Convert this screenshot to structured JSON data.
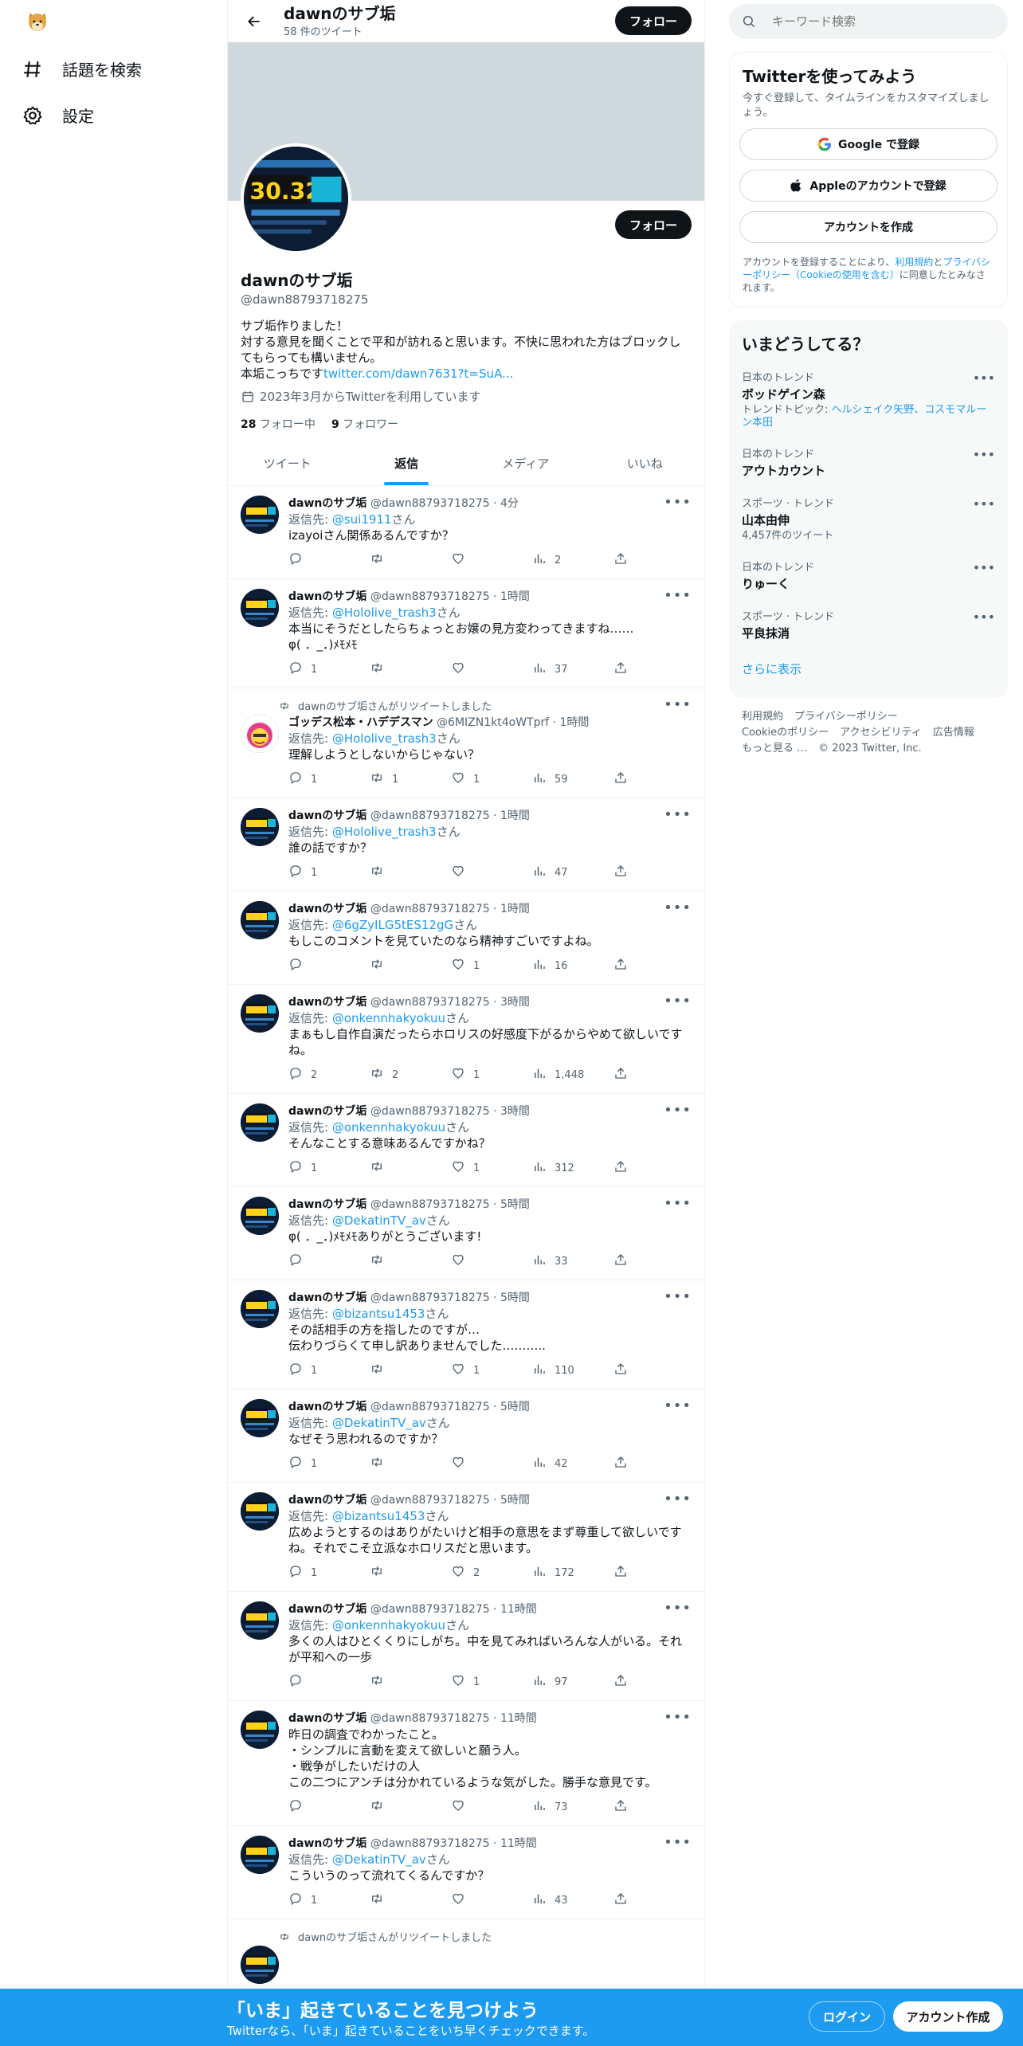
{
  "nav": {
    "explore_label": "話題を検索",
    "settings_label": "設定"
  },
  "profile": {
    "name": "dawnのサブ垢",
    "tweet_count": "58 件のツイート",
    "follow_label": "フォロー",
    "handle": "@dawn88793718275",
    "bio": "サブ垢作りました！\n対する意見を聞くことで平和が訪れると思います。不快に思われた方はブロックしてもらっても構いません。\n本垢こっちです",
    "bio_link": "twitter.com/dawn7631?t=SuA...",
    "joined": "2023年3月からTwitterを利用しています",
    "following_count": "28",
    "following_label": "フォロー中",
    "followers_count": "9",
    "followers_label": "フォロワー",
    "avatar_text": "30.325"
  },
  "tabs": [
    "ツイート",
    "返信",
    "メディア",
    "いいね"
  ],
  "tweets": [
    {
      "name": "dawnのサブ垢",
      "meta": "@dawn88793718275 · 4分",
      "reply_prefix": "返信先: ",
      "reply_to": "@sui1911",
      "reply_suffix": "さん",
      "text": "izayoiさん関係あるんですか？",
      "replies": "",
      "retweets": "",
      "likes": "",
      "views": "2"
    },
    {
      "name": "dawnのサブ垢",
      "meta": "@dawn88793718275 · 1時間",
      "reply_prefix": "返信先: ",
      "reply_to": "@Hololive_trash3",
      "reply_suffix": "さん",
      "text": "本当にそうだとしたらちょっとお嬢の見方変わってきますね……\nφ( ．_．)ﾒﾓﾒﾓ",
      "replies": "1",
      "retweets": "",
      "likes": "",
      "views": "37"
    },
    {
      "retweet_banner": "dawnのサブ垢さんがリツイートしました",
      "name": "ゴッデス松本・ハデデスマン",
      "meta": "@6MIZN1kt4oWTprf · 1時間",
      "reply_prefix": "返信先: ",
      "reply_to": "@Hololive_trash3",
      "reply_suffix": "さん",
      "text": "理解しようとしないからじゃない？",
      "replies": "1",
      "retweets": "1",
      "likes": "1",
      "views": "59"
    },
    {
      "name": "dawnのサブ垢",
      "meta": "@dawn88793718275 · 1時間",
      "reply_prefix": "返信先: ",
      "reply_to": "@Hololive_trash3",
      "reply_suffix": "さん",
      "text": "誰の話ですか？",
      "replies": "1",
      "retweets": "",
      "likes": "",
      "views": "47"
    },
    {
      "name": "dawnのサブ垢",
      "meta": "@dawn88793718275 · 1時間",
      "reply_prefix": "返信先: ",
      "reply_to": "@6gZyILG5tES12gG",
      "reply_suffix": "さん",
      "text": "もしこのコメントを見ていたのなら精神すごいですよね。",
      "replies": "",
      "retweets": "",
      "likes": "1",
      "views": "16"
    },
    {
      "name": "dawnのサブ垢",
      "meta": "@dawn88793718275 · 3時間",
      "reply_prefix": "返信先: ",
      "reply_to": "@onkennhakyokuu",
      "reply_suffix": "さん",
      "text": "まぁもし自作自演だったらホロリスの好感度下がるからやめて欲しいですね。",
      "replies": "2",
      "retweets": "2",
      "likes": "1",
      "views": "1,448"
    },
    {
      "name": "dawnのサブ垢",
      "meta": "@dawn88793718275 · 3時間",
      "reply_prefix": "返信先: ",
      "reply_to": "@onkennhakyokuu",
      "reply_suffix": "さん",
      "text": "そんなことする意味あるんですかね？",
      "replies": "1",
      "retweets": "",
      "likes": "1",
      "views": "312"
    },
    {
      "name": "dawnのサブ垢",
      "meta": "@dawn88793718275 · 5時間",
      "reply_prefix": "返信先: ",
      "reply_to": "@DekatinTV_av",
      "reply_suffix": "さん",
      "text": "φ( ．_．)ﾒﾓﾒﾓありがとうございます!",
      "replies": "",
      "retweets": "",
      "likes": "",
      "views": "33"
    },
    {
      "name": "dawnのサブ垢",
      "meta": "@dawn88793718275 · 5時間",
      "reply_prefix": "返信先: ",
      "reply_to": "@bizantsu1453",
      "reply_suffix": "さん",
      "text": "その話相手の方を指したのですが…\n伝わりづらくて申し訳ありませんでした………..",
      "replies": "1",
      "retweets": "",
      "likes": "1",
      "views": "110"
    },
    {
      "name": "dawnのサブ垢",
      "meta": "@dawn88793718275 · 5時間",
      "reply_prefix": "返信先: ",
      "reply_to": "@DekatinTV_av",
      "reply_suffix": "さん",
      "text": "なぜそう思われるのですか？",
      "replies": "1",
      "retweets": "",
      "likes": "",
      "views": "42"
    },
    {
      "name": "dawnのサブ垢",
      "meta": "@dawn88793718275 · 5時間",
      "reply_prefix": "返信先: ",
      "reply_to": "@bizantsu1453",
      "reply_suffix": "さん",
      "text": "広めようとするのはありがたいけど相手の意思をまず尊重して欲しいですね。それでこそ立派なホロリスだと思います。",
      "replies": "1",
      "retweets": "",
      "likes": "2",
      "views": "172"
    },
    {
      "name": "dawnのサブ垢",
      "meta": "@dawn88793718275 · 11時間",
      "reply_prefix": "返信先: ",
      "reply_to": "@onkennhakyokuu",
      "reply_suffix": "さん",
      "text": "多くの人はひとくくりにしがち。中を見てみればいろんな人がいる。それが平和への一歩",
      "replies": "",
      "retweets": "",
      "likes": "1",
      "views": "97"
    },
    {
      "name": "dawnのサブ垢",
      "meta": "@dawn88793718275 · 11時間",
      "reply_prefix": "",
      "reply_to": "",
      "reply_suffix": "",
      "text": "昨日の調査でわかったこと。\n・シンプルに言動を変えて欲しいと願う人。\n・戦争がしたいだけの人\nこの二つにアンチは分かれているような気がした。勝手な意見です。",
      "replies": "",
      "retweets": "",
      "likes": "",
      "views": "73"
    },
    {
      "name": "dawnのサブ垢",
      "meta": "@dawn88793718275 · 11時間",
      "reply_prefix": "返信先: ",
      "reply_to": "@DekatinTV_av",
      "reply_suffix": "さん",
      "text": "こういうのって流れてくるんですか？",
      "replies": "1",
      "retweets": "",
      "likes": "",
      "views": "43"
    },
    {
      "retweet_banner": "dawnのサブ垢さんがリツイートしました",
      "name": "",
      "meta": "",
      "reply_prefix": "",
      "reply_to": "",
      "reply_suffix": "",
      "text": "",
      "replies": "",
      "retweets": "",
      "likes": "",
      "views": ""
    }
  ],
  "search": {
    "placeholder": "キーワード検索"
  },
  "signup": {
    "title": "Twitterを使ってみよう",
    "subtitle": "今すぐ登録して、タイムラインをカスタマイズしましょう。",
    "google": "Google で登録",
    "apple": "Appleのアカウントで登録",
    "create": "アカウントを作成",
    "terms_prefix": "アカウントを登録することにより、",
    "terms_link1": "利用規約",
    "terms_mid": "と",
    "terms_link2": "プライバシーポリシー（Cookieの使用を含む）",
    "terms_suffix": "に同意したとみなされます。"
  },
  "trends": {
    "title": "いまどうしてる？",
    "items": [
      {
        "category": "日本のトレンド",
        "title": "ボッドゲイン森",
        "sub_prefix": "トレンドトピック: ",
        "sub_link": "ヘルシェイク矢野、コスモマルーン本田"
      },
      {
        "category": "日本のトレンド",
        "title": "アウトカウント",
        "sub_prefix": "",
        "sub_link": ""
      },
      {
        "category": "スポーツ · トレンド",
        "title": "山本由伸",
        "sub_prefix": "4,457件のツイート",
        "sub_link": ""
      },
      {
        "category": "日本のトレンド",
        "title": "りゅーく",
        "sub_prefix": "",
        "sub_link": ""
      },
      {
        "category": "スポーツ · トレンド",
        "title": "平良抹消",
        "sub_prefix": "",
        "sub_link": ""
      }
    ],
    "show_more": "さらに表示"
  },
  "footer": [
    "利用規約",
    "プライバシーポリシー",
    "Cookieのポリシー",
    "アクセシビリティ",
    "広告情報",
    "もっと見る …",
    "© 2023 Twitter, Inc."
  ],
  "bottom": {
    "title": "「いま」起きていることを見つけよう",
    "subtitle": "Twitterなら、「いま」起きていることをいち早くチェックできます。",
    "login": "ログイン",
    "signup": "アカウント作成"
  }
}
